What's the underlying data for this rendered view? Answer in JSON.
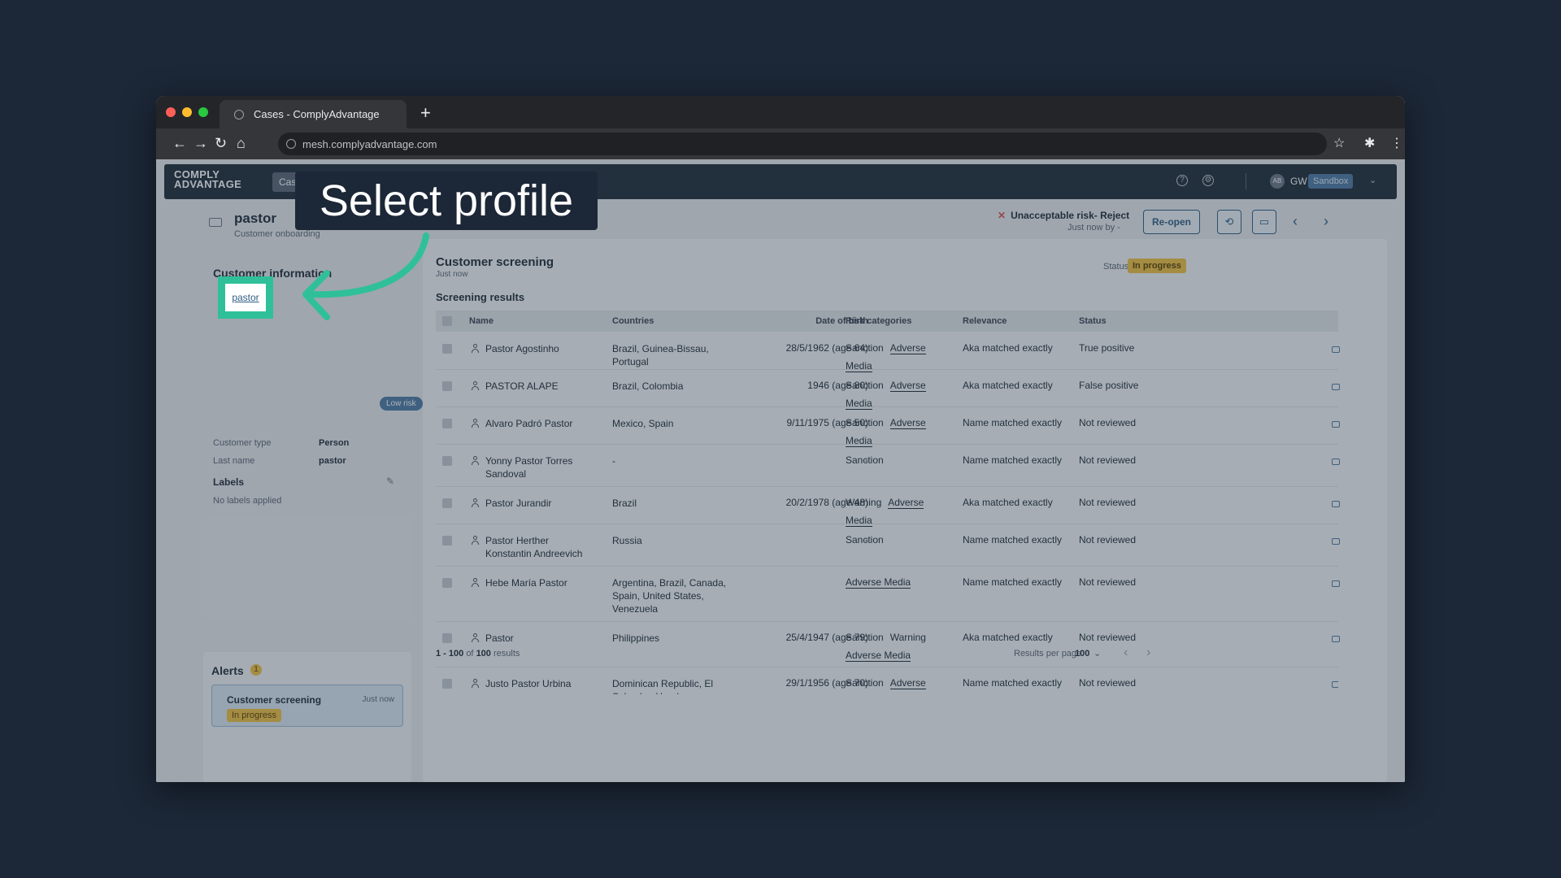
{
  "browser": {
    "tab_title": "Cases - ComplyAdvantage",
    "new_tab": "+",
    "url": "mesh.complyadvantage.com"
  },
  "app": {
    "logo_line1": "COMPLY",
    "logo_line2": "ADVANTAGE",
    "nav_active": "Cas",
    "user_avatar": "AB",
    "user_initials": "GW",
    "environment": "Sandbox"
  },
  "case": {
    "title": "pastor",
    "subtitle": "Customer onboarding",
    "decision": "Unacceptable risk- Reject",
    "decision_meta": "Just now by -",
    "reopen_label": "Re-open"
  },
  "customer_info": {
    "title": "Customer information",
    "risk_chip": "Low risk",
    "fields": [
      {
        "label": "Customer type",
        "value": "Person"
      },
      {
        "label": "Last name",
        "value": "pastor"
      }
    ],
    "labels_title": "Labels",
    "labels_empty": "No labels applied"
  },
  "alerts": {
    "title": "Alerts",
    "count": "1",
    "items": [
      {
        "name": "Customer screening",
        "time": "Just now",
        "status": "In progress"
      }
    ]
  },
  "screening": {
    "title": "Customer screening",
    "subtitle": "Just now",
    "status_label": "Status",
    "status_value": "In progress",
    "section_title": "Screening results",
    "columns": [
      "Name",
      "Countries",
      "Date of birth",
      "Risk categories",
      "Relevance",
      "Status"
    ],
    "rows": [
      {
        "name": "Pastor Agostinho",
        "countries": "Brazil, Guinea-Bissau, Portugal",
        "dob": "28/5/1962 (age 64)",
        "risk_tags": [
          "Sanction"
        ],
        "risk_links": [
          "Adverse Media"
        ],
        "relevance": "Aka matched exactly",
        "status": "True positive"
      },
      {
        "name": "PASTOR ALAPE",
        "countries": "Brazil, Colombia",
        "dob": "1946 (age 80)",
        "risk_tags": [
          "Sanction"
        ],
        "risk_links": [
          "Adverse Media"
        ],
        "relevance": "Aka matched exactly",
        "status": "False positive"
      },
      {
        "name": "Alvaro Padró Pastor",
        "countries": "Mexico, Spain",
        "dob": "9/11/1975 (age 50)",
        "risk_tags": [
          "Sanction"
        ],
        "risk_links": [
          "Adverse Media"
        ],
        "relevance": "Name matched exactly",
        "status": "Not reviewed"
      },
      {
        "name": "Yonny Pastor Torres Sandoval",
        "countries": "-",
        "dob": "-",
        "risk_tags": [
          "Sanction"
        ],
        "risk_links": [],
        "relevance": "Name matched exactly",
        "status": "Not reviewed"
      },
      {
        "name": "Pastor Jurandir",
        "countries": "Brazil",
        "dob": "20/2/1978 (age 48)",
        "risk_tags": [
          "Warning"
        ],
        "risk_links": [
          "Adverse Media"
        ],
        "relevance": "Aka matched exactly",
        "status": "Not reviewed"
      },
      {
        "name": "Pastor Herther Konstantin Andreevich",
        "countries": "Russia",
        "dob": "-",
        "risk_tags": [
          "Sanction"
        ],
        "risk_links": [],
        "relevance": "Name matched exactly",
        "status": "Not reviewed"
      },
      {
        "name": "Hebe María Pastor",
        "countries": "Argentina, Brazil, Canada, Spain, United States, Venezuela",
        "dob": "-",
        "risk_tags": [],
        "risk_links": [
          "Adverse Media"
        ],
        "relevance": "Name matched exactly",
        "status": "Not reviewed"
      },
      {
        "name": "Pastor",
        "countries": "Philippines",
        "dob": "25/4/1947 (age 79)",
        "risk_tags": [
          "Sanction",
          "Warning"
        ],
        "risk_links": [
          "Adverse Media"
        ],
        "relevance": "Aka matched exactly",
        "status": "Not reviewed"
      },
      {
        "name": "Justo Pastor Urbina",
        "countries": "Dominican Republic, El Salvador, Honduras, Nicaragua",
        "dob": "29/1/1956 (age 70)",
        "risk_tags": [
          "Sanction"
        ],
        "risk_links": [
          "Adverse Media"
        ],
        "relevance": "Name matched exactly",
        "status": "Not reviewed"
      }
    ],
    "footer_range": "1 - 100",
    "footer_of": "of",
    "footer_total": "100",
    "footer_results": "results",
    "rpp_label": "Results per page",
    "rpp_value": "100"
  },
  "overlay": {
    "label": "Select profile",
    "highlight_text": "pastor",
    "accent_color": "#2fc09a"
  },
  "colors": {
    "backdrop": "#1c2737",
    "appbar": "#1f2a37",
    "status_yellow": "#f0c040",
    "link_blue": "#2f5d85"
  }
}
